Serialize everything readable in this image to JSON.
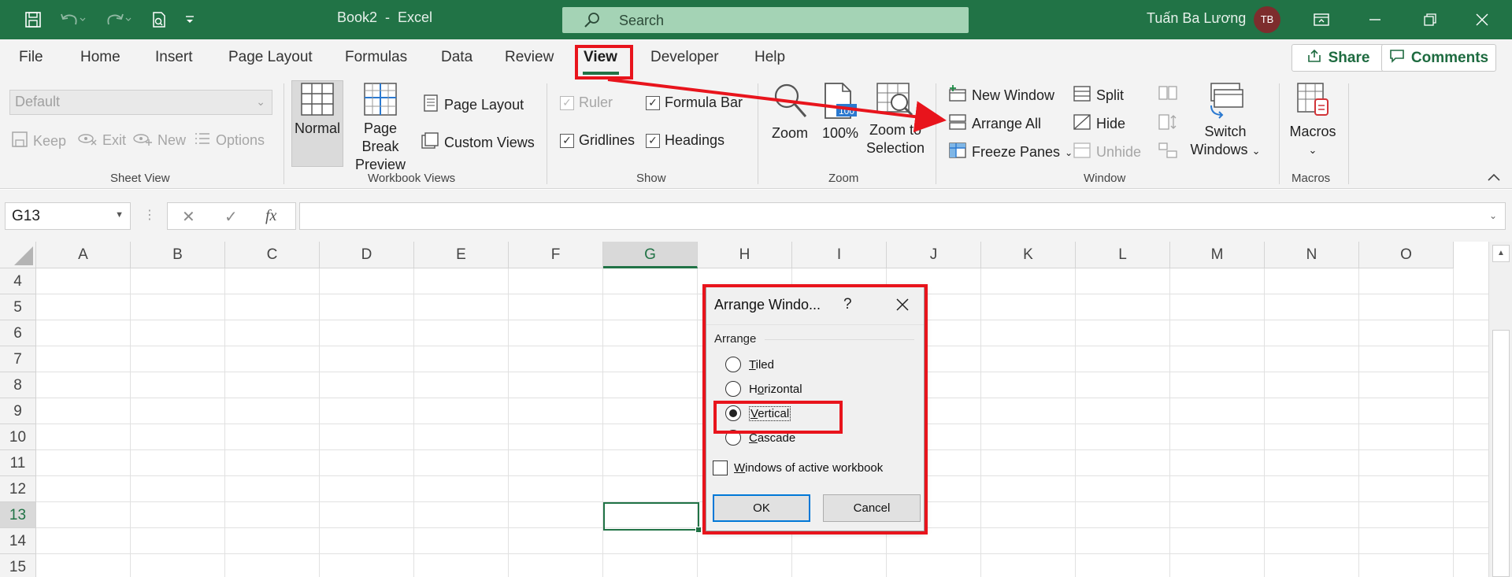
{
  "titlebar": {
    "doc_title": "Book2  -  Excel",
    "search_placeholder": "Search",
    "user_name": "Tuấn Ba Lương",
    "user_initials": "TB",
    "accent": "#217346"
  },
  "tabs": [
    "File",
    "Home",
    "Insert",
    "Page Layout",
    "Formulas",
    "Data",
    "Review",
    "View",
    "Developer",
    "Help"
  ],
  "active_tab": "View",
  "share_label": "Share",
  "comments_label": "Comments",
  "ribbon": {
    "sheet_view": {
      "label": "Sheet View",
      "select_value": "Default",
      "keep": "Keep",
      "exit": "Exit",
      "new": "New",
      "options": "Options"
    },
    "workbook_views": {
      "label": "Workbook Views",
      "normal": "Normal",
      "page_break_1": "Page Break",
      "page_break_2": "Preview",
      "page_layout": "Page Layout",
      "custom_views": "Custom Views"
    },
    "show": {
      "label": "Show",
      "ruler": "Ruler",
      "formula_bar": "Formula Bar",
      "gridlines": "Gridlines",
      "headings": "Headings"
    },
    "zoom": {
      "label": "Zoom",
      "zoom": "Zoom",
      "hundred": "100%",
      "zoom_sel_1": "Zoom to",
      "zoom_sel_2": "Selection",
      "icon_text": "100"
    },
    "window": {
      "label": "Window",
      "new_window": "New Window",
      "arrange_all": "Arrange All",
      "freeze_panes": "Freeze Panes",
      "split": "Split",
      "hide": "Hide",
      "unhide": "Unhide",
      "switch_1": "Switch",
      "switch_2": "Windows"
    },
    "macros": {
      "label": "Macros",
      "macros": "Macros"
    }
  },
  "formula_bar": {
    "name_box": "G13",
    "fx": "fx",
    "value": ""
  },
  "grid": {
    "columns": [
      "A",
      "B",
      "C",
      "D",
      "E",
      "F",
      "G",
      "H",
      "I",
      "J",
      "K",
      "L",
      "M",
      "N",
      "O"
    ],
    "rows": [
      "4",
      "5",
      "6",
      "7",
      "8",
      "9",
      "10",
      "11",
      "12",
      "13",
      "14",
      "15"
    ],
    "selected_col": "G",
    "selected_row": "13"
  },
  "dialog": {
    "title": "Arrange Windo...",
    "help": "?",
    "section": "Arrange",
    "options": [
      {
        "key": "T",
        "rest": "iled",
        "pre": ""
      },
      {
        "key": "o",
        "rest": "rizontal",
        "pre": "H"
      },
      {
        "key": "V",
        "rest": "ertical",
        "pre": ""
      },
      {
        "key": "C",
        "rest": "ascade",
        "pre": ""
      }
    ],
    "selected_option": "Vertical",
    "checkbox_key": "W",
    "checkbox_rest": "indows of active workbook",
    "ok": "OK",
    "cancel": "Cancel"
  },
  "annotation_color": "#e8141c"
}
